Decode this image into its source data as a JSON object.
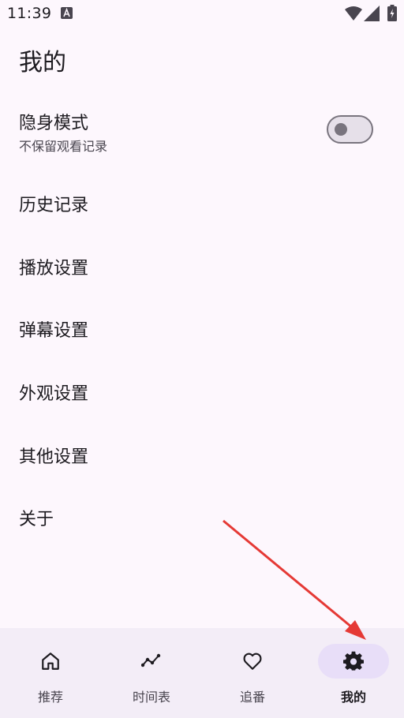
{
  "status_bar": {
    "time": "11:39"
  },
  "page": {
    "title": "我的"
  },
  "incognito": {
    "title": "隐身模式",
    "subtitle": "不保留观看记录",
    "enabled": false
  },
  "menu": {
    "items": [
      {
        "label": "历史记录"
      },
      {
        "label": "播放设置"
      },
      {
        "label": "弹幕设置"
      },
      {
        "label": "外观设置"
      },
      {
        "label": "其他设置"
      },
      {
        "label": "关于"
      }
    ]
  },
  "bottom_nav": {
    "items": [
      {
        "label": "推荐",
        "icon": "home-icon"
      },
      {
        "label": "时间表",
        "icon": "timeline-icon"
      },
      {
        "label": "追番",
        "icon": "heart-icon"
      },
      {
        "label": "我的",
        "icon": "gear-icon",
        "active": true
      }
    ]
  },
  "colors": {
    "background": "#fdf7fd",
    "nav_background": "#f3edf7",
    "active_pill": "#e8def8",
    "annotation_arrow": "#e53935"
  }
}
